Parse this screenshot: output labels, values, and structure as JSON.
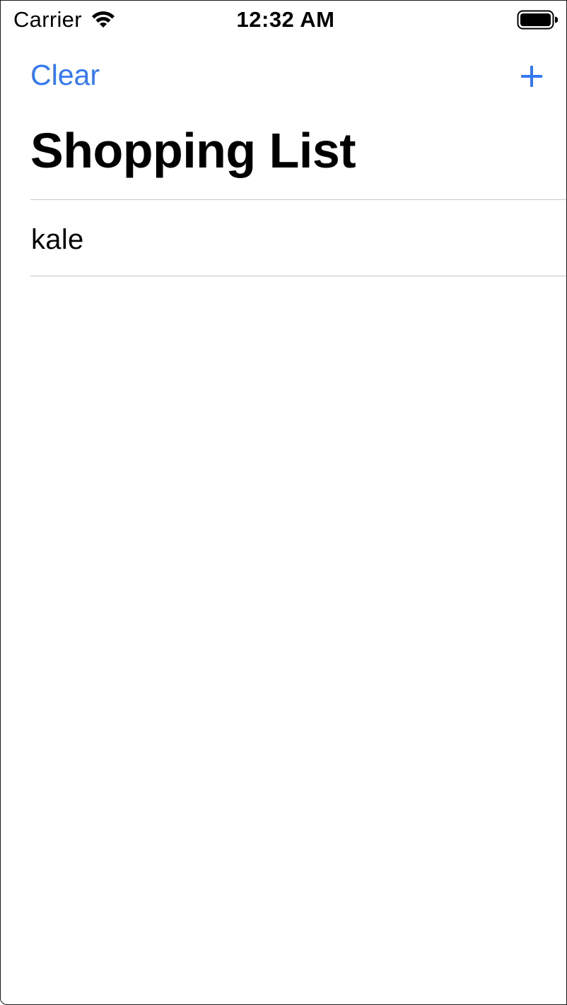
{
  "status_bar": {
    "carrier": "Carrier",
    "time": "12:32 AM",
    "wifi_icon": "wifi-icon",
    "battery_icon": "battery-full-icon"
  },
  "nav": {
    "clear_label": "Clear",
    "add_icon": "plus-icon",
    "accent_color": "#3478f6"
  },
  "page": {
    "title": "Shopping List"
  },
  "list": {
    "items": [
      {
        "label": "kale"
      }
    ]
  }
}
